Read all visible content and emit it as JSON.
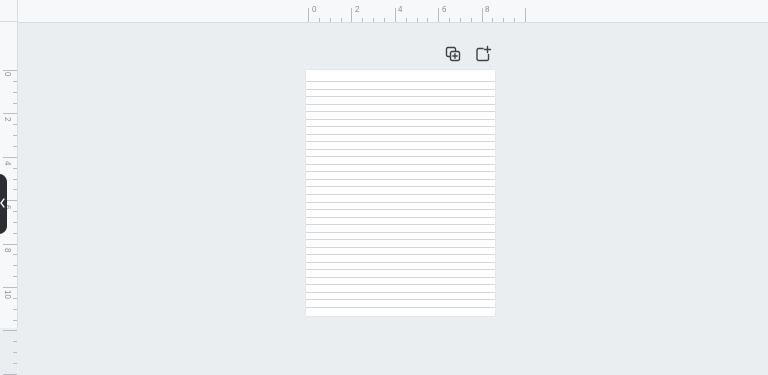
{
  "ruler": {
    "top_labels": [
      "0",
      "2",
      "4",
      "6",
      "8"
    ],
    "left_labels": [
      "0",
      "2",
      "4",
      "6",
      "8",
      "10"
    ]
  },
  "toolbar": {
    "duplicate_icon": "duplicate-page-icon",
    "add_icon": "add-page-icon"
  },
  "side_panel": {
    "toggle_icon": "chevron-left-icon"
  },
  "page": {
    "style": "ruled-paper",
    "line_count": 31,
    "line_color": "#d4d7da"
  },
  "colors": {
    "canvas": "#ebeef1",
    "ruler": "#f7f8f9",
    "panel_tab": "#2b2f33"
  }
}
